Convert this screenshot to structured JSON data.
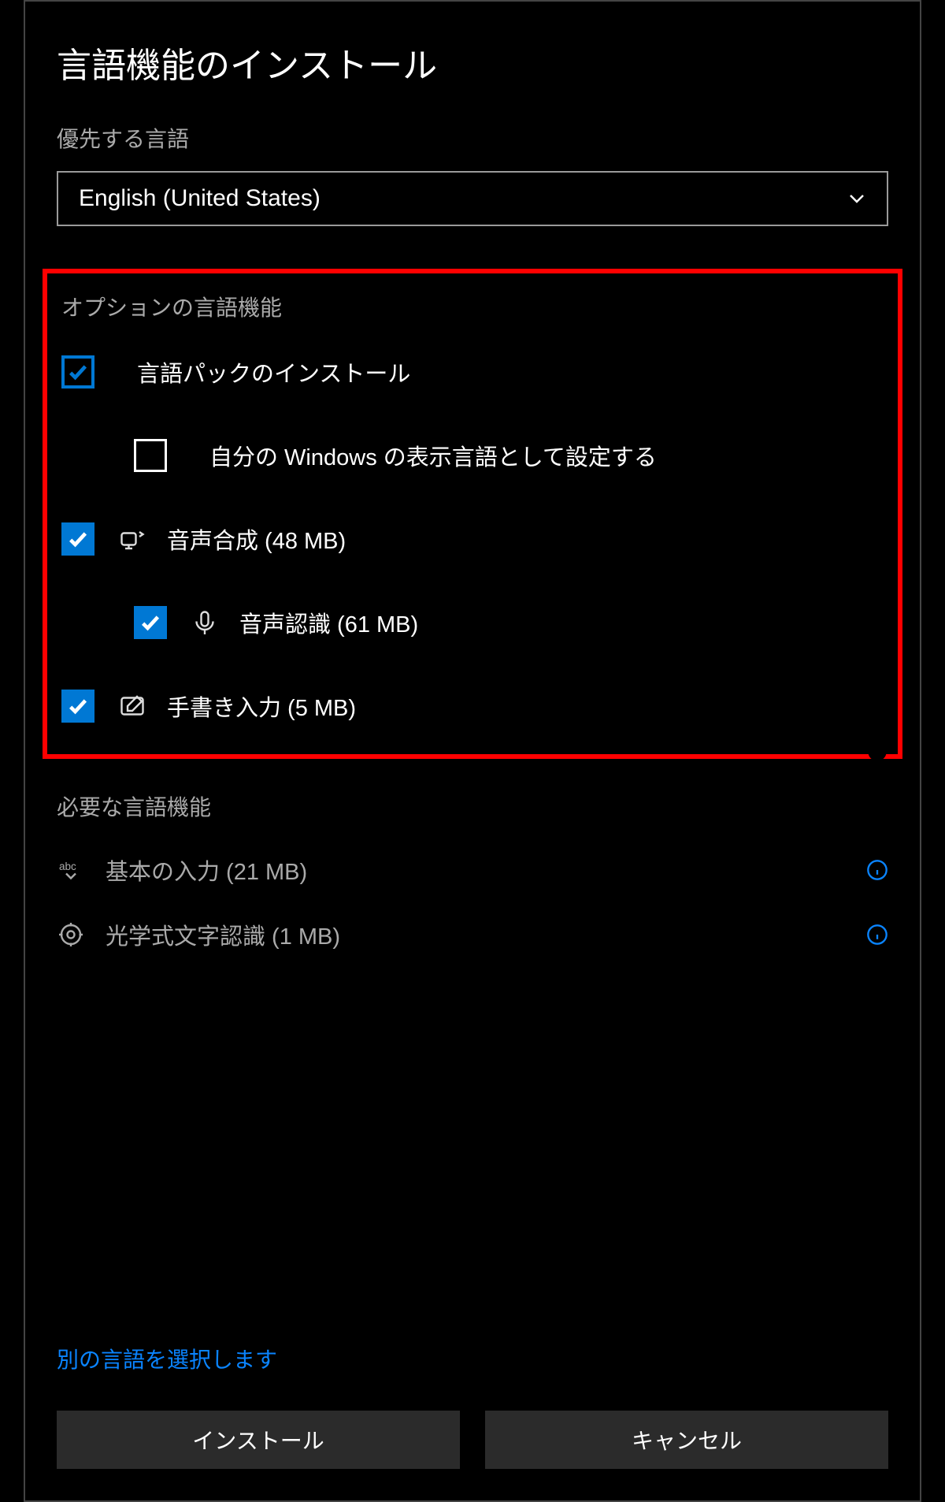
{
  "dialog": {
    "title": "言語機能のインストール",
    "preferred_language_label": "優先する言語",
    "selected_language": "English (United States)"
  },
  "optional_section": {
    "title": "オプションの言語機能",
    "items": [
      {
        "label": "言語パックのインストール",
        "checked": true,
        "style": "outline",
        "indent": 0,
        "icon": null
      },
      {
        "label": "自分の Windows の表示言語として設定する",
        "checked": false,
        "style": "empty",
        "indent": 1,
        "icon": null
      },
      {
        "label": "音声合成 (48 MB)",
        "checked": true,
        "style": "fill",
        "indent": 0,
        "icon": "tts"
      },
      {
        "label": "音声認識 (61 MB)",
        "checked": true,
        "style": "fill",
        "indent": 1,
        "icon": "mic"
      },
      {
        "label": "手書き入力 (5 MB)",
        "checked": true,
        "style": "fill",
        "indent": 0,
        "icon": "pen"
      }
    ]
  },
  "required_section": {
    "title": "必要な言語機能",
    "items": [
      {
        "label": "基本の入力 (21 MB)",
        "icon": "abc"
      },
      {
        "label": "光学式文字認識 (1 MB)",
        "icon": "ocr"
      }
    ]
  },
  "footer": {
    "select_other_link": "別の言語を選択します",
    "install_button": "インストール",
    "cancel_button": "キャンセル"
  }
}
